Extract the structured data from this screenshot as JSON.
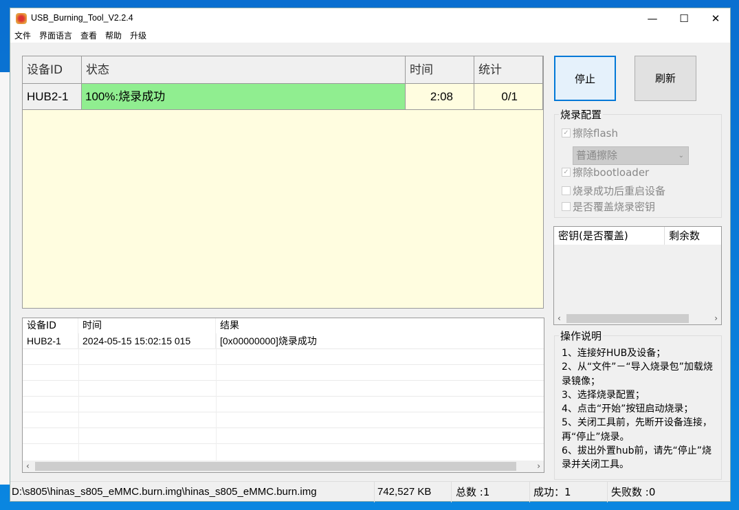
{
  "window": {
    "title": "USB_Burning_Tool_V2.2.4",
    "minimize": "—",
    "maximize": "☐",
    "close": "✕"
  },
  "menu": [
    "文件",
    "界面语言",
    "查看",
    "帮助",
    "升级"
  ],
  "device_grid": {
    "headers": [
      "设备ID",
      "状态",
      "时间",
      "统计"
    ],
    "rows": [
      {
        "id": "HUB2-1",
        "status": "100%:烧录成功",
        "progress_percent": 100,
        "time": "2:08",
        "count": "0/1"
      }
    ],
    "status_color": "#90ee90"
  },
  "buttons": {
    "stop": "停止",
    "refresh": "刷新"
  },
  "config": {
    "title": "烧录配置",
    "erase_flash": {
      "label": "擦除flash",
      "checked": true
    },
    "erase_mode": "普通擦除",
    "erase_bootloader": {
      "label": "擦除bootloader",
      "checked": true
    },
    "reboot_after": {
      "label": "烧录成功后重启设备",
      "checked": false
    },
    "overwrite_key": {
      "label": "是否覆盖烧录密钥",
      "checked": false
    }
  },
  "key_list": {
    "headers": [
      "密钥(是否覆盖)",
      "剩余数"
    ]
  },
  "help": {
    "title": "操作说明",
    "lines": [
      "1、连接好HUB及设备；",
      "2、从“文件”－“导入烧录包”加载烧录镜像；",
      "3、选择烧录配置；",
      "4、点击“开始”按钮启动烧录；",
      "5、关闭工具前，先断开设备连接，再“停止”烧录。",
      "6、拔出外置hub前，请先“停止”烧录并关闭工具。"
    ]
  },
  "log": {
    "headers": [
      "设备ID",
      "时间",
      "结果"
    ],
    "rows": [
      {
        "id": "HUB2-1",
        "time": "2024-05-15 15:02:15 015",
        "result": "[0x00000000]烧录成功"
      }
    ]
  },
  "statusbar": {
    "path": "D:\\s805\\hinas_s805_eMMC.burn.img\\hinas_s805_eMMC.burn.img",
    "size": "742,527 KB",
    "total": "总数 :1",
    "success": "成功：1",
    "fail": "失败数 :0"
  }
}
